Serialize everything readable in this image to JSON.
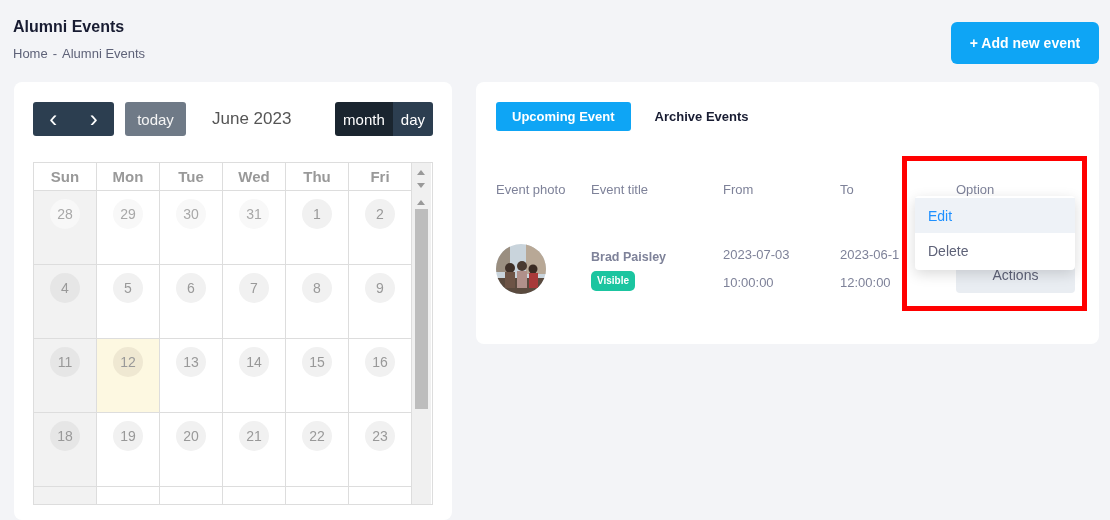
{
  "page": {
    "title": "Alumni Events",
    "breadcrumb": {
      "items": [
        "Home",
        "Alumni Events"
      ],
      "separator": "-"
    },
    "add_button": "+ Add new event"
  },
  "calendar": {
    "nav": [
      "‹",
      "›"
    ],
    "today_button": "today",
    "month_label": "June 2023",
    "views": [
      {
        "label": "month",
        "selected": true
      },
      {
        "label": "day",
        "selected": false
      }
    ],
    "weekdays": [
      "Sun",
      "Mon",
      "Tue",
      "Wed",
      "Thu",
      "Fri"
    ],
    "weeks": [
      [
        {
          "day": "28",
          "other_month": true,
          "today": false
        },
        {
          "day": "29",
          "other_month": true,
          "today": false
        },
        {
          "day": "30",
          "other_month": true,
          "today": false
        },
        {
          "day": "31",
          "other_month": true,
          "today": false
        },
        {
          "day": "1",
          "other_month": false,
          "today": false
        },
        {
          "day": "2",
          "other_month": false,
          "today": false
        }
      ],
      [
        {
          "day": "4",
          "other_month": false,
          "today": false
        },
        {
          "day": "5",
          "other_month": false,
          "today": false
        },
        {
          "day": "6",
          "other_month": false,
          "today": false
        },
        {
          "day": "7",
          "other_month": false,
          "today": false
        },
        {
          "day": "8",
          "other_month": false,
          "today": false
        },
        {
          "day": "9",
          "other_month": false,
          "today": false
        }
      ],
      [
        {
          "day": "11",
          "other_month": false,
          "today": false
        },
        {
          "day": "12",
          "other_month": false,
          "today": true
        },
        {
          "day": "13",
          "other_month": false,
          "today": false
        },
        {
          "day": "14",
          "other_month": false,
          "today": false
        },
        {
          "day": "15",
          "other_month": false,
          "today": false
        },
        {
          "day": "16",
          "other_month": false,
          "today": false
        }
      ],
      [
        {
          "day": "18",
          "other_month": false,
          "today": false
        },
        {
          "day": "19",
          "other_month": false,
          "today": false
        },
        {
          "day": "20",
          "other_month": false,
          "today": false
        },
        {
          "day": "21",
          "other_month": false,
          "today": false
        },
        {
          "day": "22",
          "other_month": false,
          "today": false
        },
        {
          "day": "23",
          "other_month": false,
          "today": false
        }
      ]
    ]
  },
  "events": {
    "tabs": [
      {
        "label": "Upcoming Event",
        "selected": true
      },
      {
        "label": "Archive Events",
        "selected": false
      }
    ],
    "columns": [
      "Event photo",
      "Event title",
      "From",
      "To",
      "Option"
    ],
    "rows": [
      {
        "title": "Brad Paisley",
        "badge": "Visible",
        "from": [
          "2023-07-03",
          "10:00:00"
        ],
        "to": [
          "2023-06-1",
          "12:00:00"
        ],
        "action": "Actions"
      }
    ],
    "menu": [
      {
        "label": "Edit",
        "selected": true
      },
      {
        "label": "Delete",
        "selected": false
      }
    ],
    "option_highlighted": true
  }
}
